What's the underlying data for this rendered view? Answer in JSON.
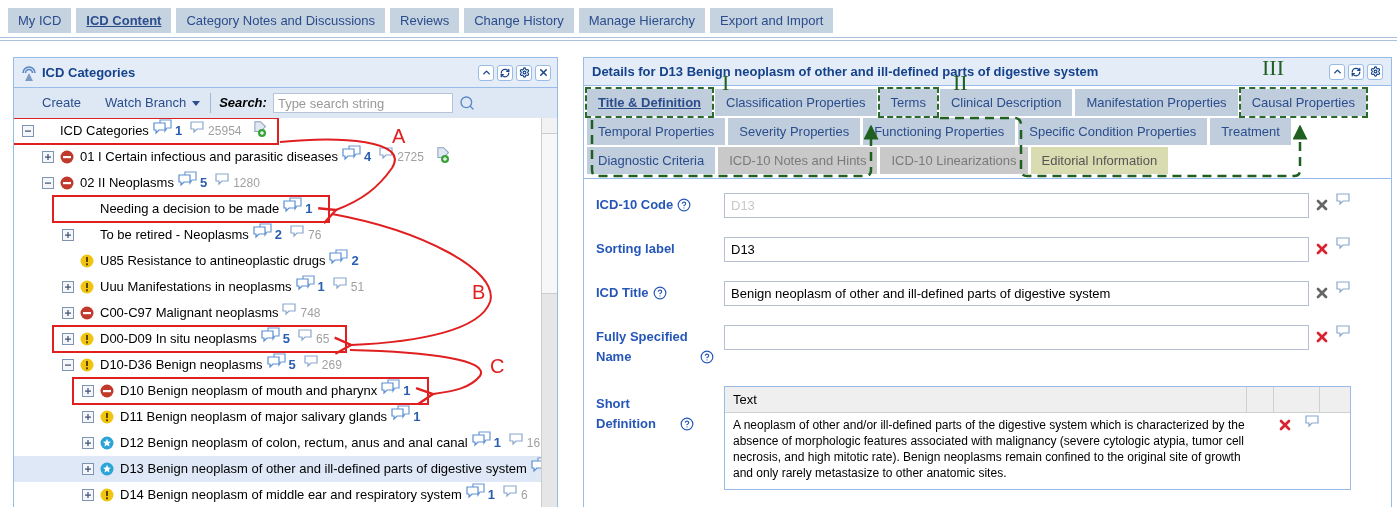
{
  "top_tabs": [
    {
      "label": "My ICD",
      "selected": false
    },
    {
      "label": "ICD Content",
      "selected": true
    },
    {
      "label": "Category Notes and Discussions",
      "selected": false
    },
    {
      "label": "Reviews",
      "selected": false
    },
    {
      "label": "Change History",
      "selected": false
    },
    {
      "label": "Manage Hierarchy",
      "selected": false
    },
    {
      "label": "Export and Import",
      "selected": false
    }
  ],
  "categories_panel": {
    "title": "ICD Categories",
    "toolbar": {
      "create": "Create",
      "watch_branch": "Watch Branch",
      "search_label": "Search:",
      "search_placeholder": "Type search string"
    },
    "tree": [
      {
        "label": "ICD Categories",
        "expandable": true,
        "expanded": true,
        "notes": "1",
        "threads": "25954",
        "tag": true,
        "selected": false,
        "boxed": true,
        "children": [
          {
            "label": "01 I Certain infectious and parasitic diseases",
            "kind": "blocked",
            "expandable": true,
            "expanded": false,
            "notes": "4",
            "threads": "2725",
            "tag": true,
            "selected": false,
            "boxed": false
          },
          {
            "label": "02 II Neoplasms",
            "kind": "blocked",
            "expandable": true,
            "expanded": true,
            "notes": "5",
            "threads": "1280",
            "tag": false,
            "selected": false,
            "boxed": false,
            "children": [
              {
                "label": "Needing a decision to be made",
                "expandable": false,
                "notes": "1",
                "tag": false,
                "selected": false,
                "boxed": true
              },
              {
                "label": "To be retired - Neoplasms",
                "expandable": true,
                "expanded": false,
                "notes": "2",
                "threads": "76",
                "tag": false,
                "selected": false,
                "boxed": false
              },
              {
                "label": "U85 Resistance to antineoplastic drugs",
                "kind": "warning",
                "expandable": false,
                "notes": "2",
                "tag": false,
                "selected": false,
                "boxed": false
              },
              {
                "label": "Uuu Manifestations in neoplasms",
                "kind": "warning",
                "expandable": true,
                "expanded": false,
                "notes": "1",
                "threads": "51",
                "tag": false,
                "selected": false,
                "boxed": false
              },
              {
                "label": "C00-C97 Malignant neoplasms",
                "kind": "blocked",
                "expandable": true,
                "expanded": false,
                "threads": "748",
                "tag": false,
                "selected": false,
                "boxed": false
              },
              {
                "label": "D00-D09 In situ neoplasms",
                "kind": "warning",
                "expandable": true,
                "expanded": false,
                "notes": "5",
                "threads": "65",
                "tag": false,
                "selected": false,
                "boxed": true
              },
              {
                "label": "D10-D36 Benign neoplasms",
                "kind": "warning",
                "expandable": true,
                "expanded": true,
                "notes": "5",
                "threads": "269",
                "tag": false,
                "selected": false,
                "boxed": false,
                "children": [
                  {
                    "label": "D10 Benign neoplasm of mouth and pharynx",
                    "kind": "blocked",
                    "expandable": true,
                    "expanded": false,
                    "notes": "1",
                    "tag": false,
                    "selected": false,
                    "boxed": true
                  },
                  {
                    "label": "D11 Benign neoplasm of major salivary glands",
                    "kind": "warning",
                    "expandable": true,
                    "expanded": false,
                    "notes": "1",
                    "tag": false,
                    "selected": false,
                    "boxed": false
                  },
                  {
                    "label": "D12 Benign neoplasm of colon, rectum, anus and anal canal",
                    "kind": "star",
                    "expandable": true,
                    "expanded": false,
                    "notes": "1",
                    "threads": "16",
                    "tag": false,
                    "selected": false,
                    "boxed": false
                  },
                  {
                    "label": "D13 Benign neoplasm of other and ill-defined parts of digestive system",
                    "kind": "star",
                    "expandable": true,
                    "expanded": false,
                    "has_notes": true,
                    "tag": false,
                    "selected": true,
                    "boxed": false
                  },
                  {
                    "label": "D14 Benign neoplasm of middle ear and respiratory system",
                    "kind": "warning",
                    "expandable": true,
                    "expanded": false,
                    "notes": "1",
                    "threads": "6",
                    "tag": false,
                    "selected": false,
                    "boxed": false
                  }
                ]
              }
            ]
          }
        ]
      }
    ]
  },
  "tree_annotations": [
    {
      "label": "A"
    },
    {
      "label": "B"
    },
    {
      "label": "C"
    }
  ],
  "details_panel": {
    "title": "Details for D13 Benign neoplasm of other and ill-defined parts of digestive system",
    "tab_rows": [
      [
        {
          "label": "Title & Definition",
          "kind": "normal",
          "selected": true,
          "boxed": true
        },
        {
          "label": "Classification Properties",
          "kind": "normal",
          "selected": false,
          "boxed": false
        },
        {
          "label": "Terms",
          "kind": "normal",
          "selected": false,
          "boxed": true
        },
        {
          "label": "Clinical Description",
          "kind": "normal",
          "selected": false,
          "boxed": false
        },
        {
          "label": "Manifestation Properties",
          "kind": "normal",
          "selected": false,
          "boxed": false
        },
        {
          "label": "Causal Properties",
          "kind": "normal",
          "selected": false,
          "boxed": true
        }
      ],
      [
        {
          "label": "Temporal Properties",
          "kind": "normal",
          "selected": false,
          "boxed": false
        },
        {
          "label": "Severity Properties",
          "kind": "normal",
          "selected": false,
          "boxed": false
        },
        {
          "label": "Functioning Properties",
          "kind": "normal",
          "selected": false,
          "boxed": false
        },
        {
          "label": "Specific Condition Properties",
          "kind": "normal",
          "selected": false,
          "boxed": false
        },
        {
          "label": "Treatment",
          "kind": "normal",
          "selected": false,
          "boxed": false
        }
      ],
      [
        {
          "label": "Diagnostic Criteria",
          "kind": "normal",
          "selected": false,
          "boxed": false
        },
        {
          "label": "ICD-10 Notes and Hints",
          "kind": "inactive",
          "selected": false,
          "boxed": false
        },
        {
          "label": "ICD-10 Linearizations",
          "kind": "inactive",
          "selected": false,
          "boxed": false
        },
        {
          "label": "Editorial Information",
          "kind": "editorial",
          "selected": false,
          "boxed": false
        }
      ]
    ],
    "fields": [
      {
        "label": "ICD-10 Code",
        "help": true,
        "value": "D13",
        "disabled": true,
        "removable": false
      },
      {
        "label": "Sorting label",
        "help": false,
        "value": "D13",
        "disabled": false,
        "removable": true
      },
      {
        "label": "ICD Title",
        "help": true,
        "value": "Benign neoplasm of other and ill-defined parts of digestive system",
        "disabled": false,
        "removable": false
      },
      {
        "label": "Fully Specified Name",
        "help": true,
        "disabled": false,
        "removable": true
      }
    ],
    "short_definition": {
      "label": "Short Definition",
      "column": "Text",
      "text": "A neoplasm of other and/or ill-defined parts of the digestive system which is characterized by the absence of morphologic features associated with malignancy (severe cytologic atypia, tumor cell necrosis, and high mitotic rate). Benign neoplasms remain confined to the original site of growth and only rarely metastasize to other anatomic sites."
    }
  },
  "tab_annotations": [
    {
      "label": "I"
    },
    {
      "label": "II"
    },
    {
      "label": "III"
    }
  ]
}
